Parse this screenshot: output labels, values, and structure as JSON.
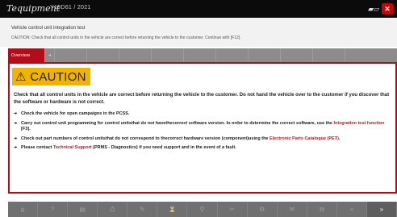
{
  "titlebar": {
    "brand": "Tequipment",
    "vin": "Y19D61 / 2021",
    "signal_glyph": "▰▱",
    "close_glyph": "✕"
  },
  "header": {
    "title": "Vehicle control unit integration test",
    "instruction": "CAUTION: Check that all control units in the vehicle are correct before returning the vehicle to the customer. Continue with [F12]."
  },
  "tabs": {
    "active_label": "Overview"
  },
  "caution": {
    "symbol": "⚠",
    "label": "CAUTION",
    "intro": "Check that all control units in the vehicle are correct before returning the vehicle to the customer. Do not hand the vehicle over to the customer if you discover that the software or hardware is not correct.",
    "bullets": [
      {
        "text": "Check the vehicle for open campaigns in the PCSS."
      },
      {
        "pre": "Carry out control unit programming for control unitsthat do not havethecorrect software version. In order to determine the correct software, use the ",
        "link": "Integration test function",
        "post": " [F3]."
      },
      {
        "pre": "Check out part numbers of control unitsthat do not correspond to thecorrect hardware version (component)using the ",
        "link": "Electronic Parts Catalogue (PET)",
        "post": "."
      },
      {
        "pre": "Please contact ",
        "link": "Technical Support",
        "post": " (PRMS - Diagnostics) if you need support and in the event of a fault."
      }
    ]
  },
  "colors": {
    "accent": "#b10d1b",
    "caution_bg": "#f0b400",
    "link": "#c8141e"
  },
  "bottombar": {
    "items": [
      "⌂",
      "?",
      "▤",
      "⎙",
      "✎",
      "⏳",
      "⚲",
      "✂",
      "⚙",
      "✉",
      "⧉",
      "«",
      "»"
    ]
  }
}
